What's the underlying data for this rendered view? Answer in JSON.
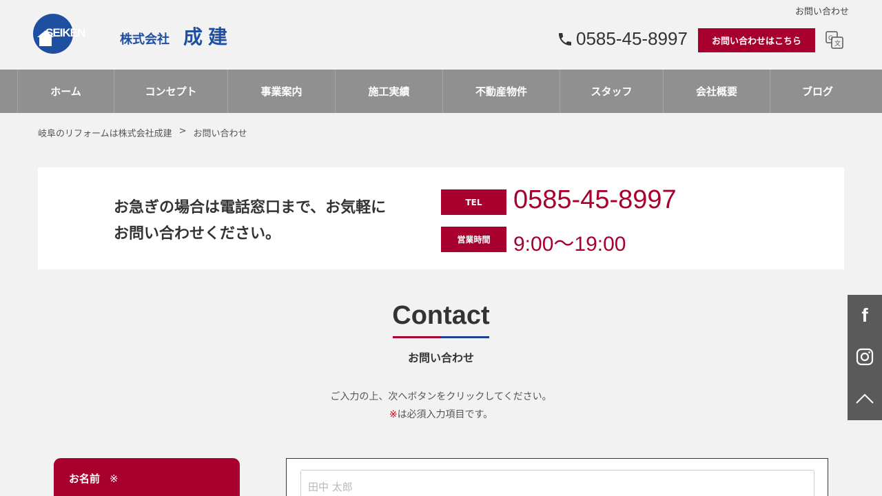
{
  "header": {
    "logo_text": "SEIKEN",
    "company_prefix": "株式会社",
    "company_name": "成建",
    "top_link": "お問い合わせ",
    "phone": "0585-45-8997",
    "contact_button": "お問い合わせはこちら"
  },
  "nav": {
    "items": [
      {
        "label": "ホーム"
      },
      {
        "label": "コンセプト"
      },
      {
        "label": "事業案内"
      },
      {
        "label": "施工実績"
      },
      {
        "label": "不動産物件"
      },
      {
        "label": "スタッフ"
      },
      {
        "label": "会社概要"
      },
      {
        "label": "ブログ"
      }
    ]
  },
  "breadcrumb": {
    "home": "岐阜のリフォームは株式会社成建",
    "separator": ">",
    "current": "お問い合わせ"
  },
  "callbox": {
    "message_line1": "お急ぎの場合は電話窓口まで、お気軽に",
    "message_line2": "お問い合わせください。",
    "tel_tag": "TEL",
    "tel": "0585-45-8997",
    "hours_tag": "営業時間",
    "hours": "9:00〜19:00"
  },
  "contact": {
    "title": "Contact",
    "subtitle": "お問い合わせ",
    "note_line1": "ご入力の上、次へボタンをクリックしてください。",
    "note_required_mark": "※",
    "note_line2": "は必須入力項目です。"
  },
  "form": {
    "name_label": "お名前",
    "required_mark": "※",
    "name_placeholder": "田中 太郎"
  },
  "colors": {
    "accent": "#a8002e",
    "brand_blue": "#1f4fa1",
    "nav_bg": "#909090",
    "side_bg": "#5a5a5a"
  },
  "icons": {
    "phone": "phone-icon",
    "translate": "translate-icon",
    "facebook": "facebook-icon",
    "instagram": "instagram-icon",
    "page_top": "chevron-up-icon"
  }
}
